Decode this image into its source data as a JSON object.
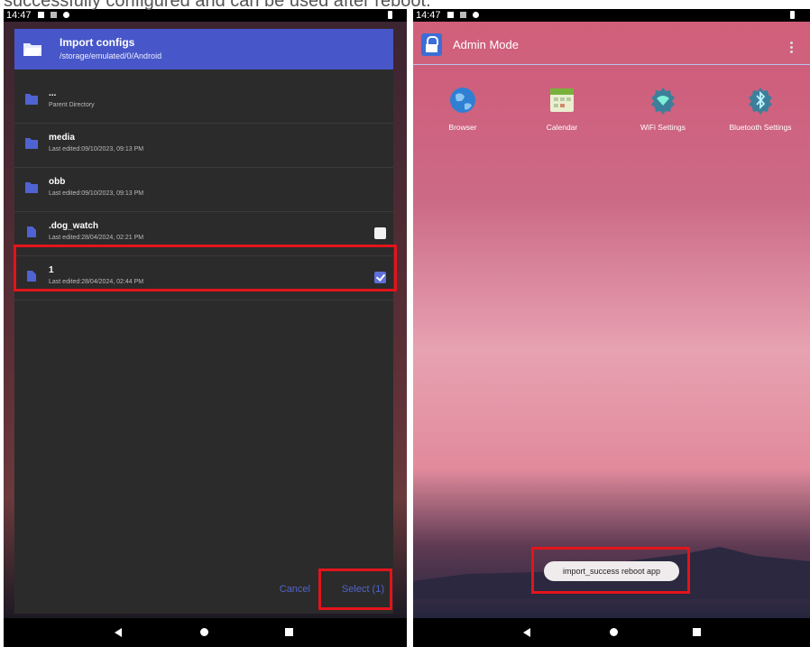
{
  "caption": "successfully configured and can be used after reboot.",
  "left_screen": {
    "status_time": "14:47",
    "dialog": {
      "title": "Import configs",
      "path": "/storage/emulated/0/Android",
      "items": [
        {
          "name": "...",
          "meta": "Parent Directory",
          "checkbox": false,
          "checked": false
        },
        {
          "name": "media",
          "meta": "Last edited:09/10/2023, 09:13 PM",
          "checkbox": false,
          "checked": false
        },
        {
          "name": "obb",
          "meta": "Last edited:09/10/2023, 09:13 PM",
          "checkbox": false,
          "checked": false
        },
        {
          "name": ".dog_watch",
          "meta": "Last edited:28/04/2024, 02:21 PM",
          "checkbox": true,
          "checked": false
        },
        {
          "name": "1",
          "meta": "Last edited:28/04/2024, 02:44 PM",
          "checkbox": true,
          "checked": true
        }
      ],
      "cancel_label": "Cancel",
      "select_label": "Select (1)"
    }
  },
  "right_screen": {
    "status_time": "14:47",
    "app_title": "Admin Mode",
    "apps": [
      {
        "label": "Browser",
        "icon": "globe-icon"
      },
      {
        "label": "Calendar",
        "icon": "calendar-icon"
      },
      {
        "label": "WiFi Settings",
        "icon": "wifi-settings-icon"
      },
      {
        "label": "Bluetooth Settings",
        "icon": "bluetooth-settings-icon"
      }
    ],
    "toast": "import_success reboot app"
  },
  "colors": {
    "dialog_header": "#4757c9",
    "highlight": "#e3141b",
    "accent_button": "#5264c9"
  }
}
